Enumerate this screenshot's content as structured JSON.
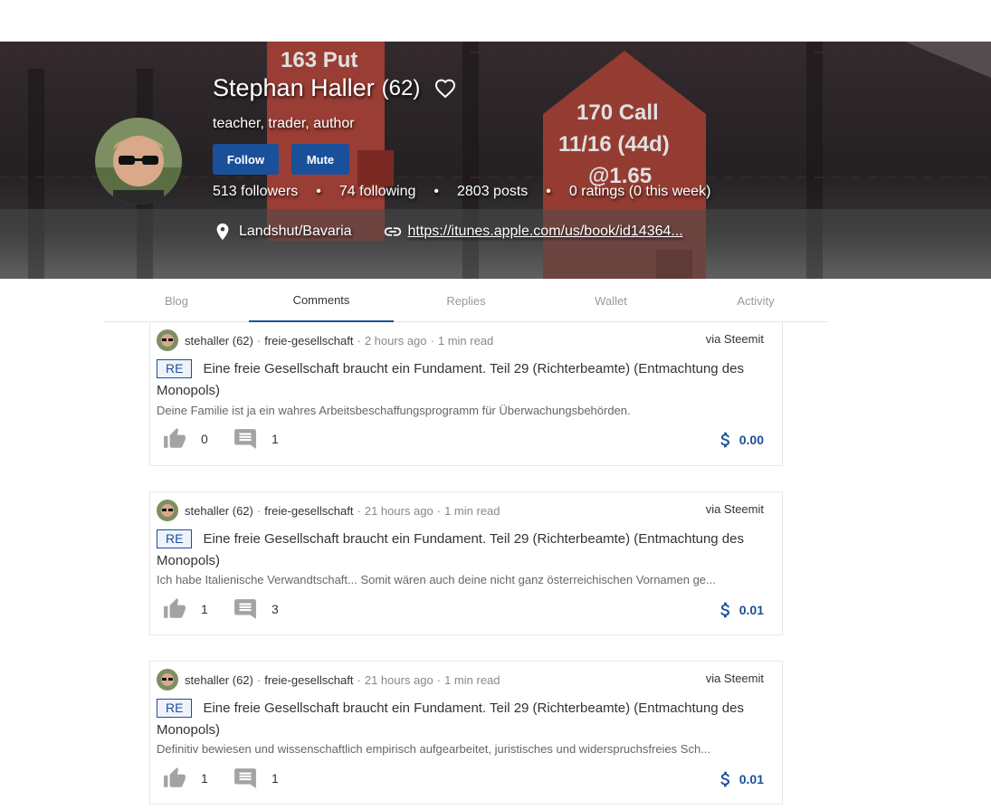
{
  "profile": {
    "name": "Stephan Haller",
    "reputation": "(62)",
    "about": "teacher, trader, author",
    "follow_label": "Follow",
    "mute_label": "Mute",
    "followers": "513 followers",
    "following": "74 following",
    "posts": "2803 posts",
    "ratings": "0 ratings (0 this week)",
    "separator": "•",
    "location": "Landshut/Bavaria",
    "website": "https://itunes.apple.com/us/book/id14364..."
  },
  "cover_text": {
    "put_line1": "163 Put",
    "call_line1": "170 Call",
    "call_line2": "11/16 (44d)",
    "call_line3": "@1.65"
  },
  "tabs": [
    {
      "label": "Blog"
    },
    {
      "label": "Comments"
    },
    {
      "label": "Replies"
    },
    {
      "label": "Wallet"
    },
    {
      "label": "Activity"
    }
  ],
  "posts": [
    {
      "author": "stehaller (62)",
      "sep": "·",
      "category": "freie-gesellschaft",
      "time": "2 hours ago",
      "read": "1 min read",
      "via": "via Steemit",
      "badge": "RE",
      "title": "Eine freie Gesellschaft braucht ein Fundament. Teil 29 (Richterbeamte) (Entmachtung des Monopols)",
      "excerpt": "Deine Familie ist ja ein wahres Arbeitsbeschaffungsprogramm für Überwachungsbehörden.",
      "votes": "0",
      "comments": "1",
      "payout": "0.00"
    },
    {
      "author": "stehaller (62)",
      "sep": "·",
      "category": "freie-gesellschaft",
      "time": "21 hours ago",
      "read": "1 min read",
      "via": "via Steemit",
      "badge": "RE",
      "title": "Eine freie Gesellschaft braucht ein Fundament. Teil 29 (Richterbeamte) (Entmachtung des Monopols)",
      "excerpt": "Ich habe Italienische Verwandtschaft... Somit wären auch deine nicht ganz österreichischen Vornamen ge...",
      "votes": "1",
      "comments": "3",
      "payout": "0.01"
    },
    {
      "author": "stehaller (62)",
      "sep": "·",
      "category": "freie-gesellschaft",
      "time": "21 hours ago",
      "read": "1 min read",
      "via": "via Steemit",
      "badge": "RE",
      "title": "Eine freie Gesellschaft braucht ein Fundament. Teil 29 (Richterbeamte) (Entmachtung des Monopols)",
      "excerpt": "Definitiv bewiesen und wissenschaftlich empirisch aufgearbeitet, juristisches und widerspruchsfreies Sch...",
      "votes": "1",
      "comments": "1",
      "payout": "0.01"
    }
  ],
  "colors": {
    "accent": "#1a5099",
    "muted_icon": "#a3a3a3"
  },
  "icons": {
    "like": "thumb-up-icon",
    "comment": "comment-icon",
    "payout": "dollar-icon",
    "location": "location-pin-icon",
    "link": "link-icon",
    "heart": "heart-outline-icon"
  }
}
